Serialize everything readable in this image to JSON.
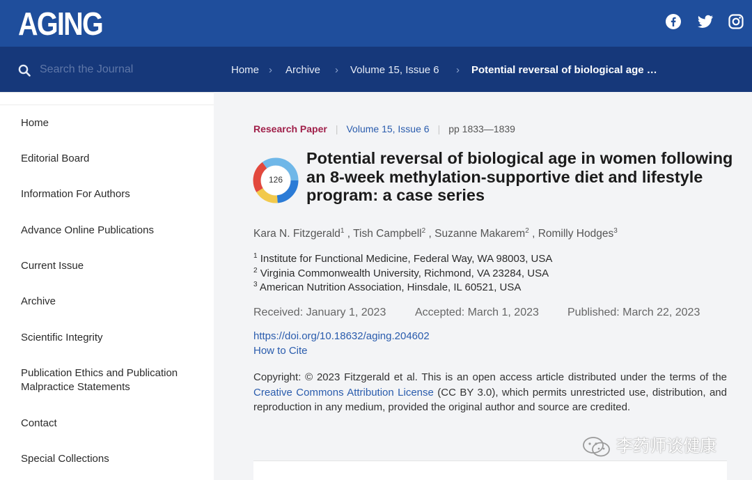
{
  "header": {
    "logo_text": "AGING",
    "social_icons": [
      "facebook-icon",
      "twitter-icon",
      "instagram-icon"
    ]
  },
  "nav": {
    "search_placeholder": "Search the Journal",
    "breadcrumbs": [
      "Home",
      "Archive",
      "Volume 15, Issue 6",
      "Potential reversal of biological age …"
    ]
  },
  "sidebar": {
    "items": [
      "Home",
      "Editorial Board",
      "Information For Authors",
      "Advance Online Publications",
      "Current Issue",
      "Archive",
      "Scientific Integrity",
      "Publication Ethics and Publication Malpractice Statements",
      "Contact",
      "Special Collections"
    ]
  },
  "article": {
    "type": "Research Paper",
    "volume": "Volume 15, Issue 6",
    "pages": "pp 1833—1839",
    "altmetric_score": "126",
    "title": "Potential reversal of biological age in women following an 8-week methylation-supportive diet and lifestyle program: a case series",
    "authors": [
      {
        "name": "Kara N. Fitzgerald",
        "sup": "1"
      },
      {
        "name": "Tish Campbell",
        "sup": "2"
      },
      {
        "name": "Suzanne Makarem",
        "sup": "2"
      },
      {
        "name": "Romilly Hodges",
        "sup": "3"
      }
    ],
    "affiliations": [
      {
        "sup": "1",
        "text": "Institute for Functional Medicine, Federal Way, WA 98003, USA"
      },
      {
        "sup": "2",
        "text": "Virginia Commonwealth University, Richmond, VA 23284, USA"
      },
      {
        "sup": "3",
        "text": "American Nutrition Association, Hinsdale, IL 60521, USA"
      }
    ],
    "received": "Received: January 1, 2023",
    "accepted": "Accepted: March 1, 2023",
    "published": "Published: March 22, 2023",
    "doi": "https://doi.org/10.18632/aging.204602",
    "how_to_cite": "How to Cite",
    "copyright_before": "Copyright: © 2023 Fitzgerald et al. This is an open access article distributed under the terms of the ",
    "license_link": "Creative Commons Attribution License",
    "copyright_after": " (CC BY 3.0), which permits unrestricted use, distribution, and reproduction in any medium, provided the original author and source are credited."
  },
  "watermark": {
    "text": "李药师谈健康"
  },
  "colors": {
    "topbar": "#1f4e9c",
    "navbar": "#16387a",
    "paper_type": "#a0204a",
    "link": "#2a5cad"
  }
}
